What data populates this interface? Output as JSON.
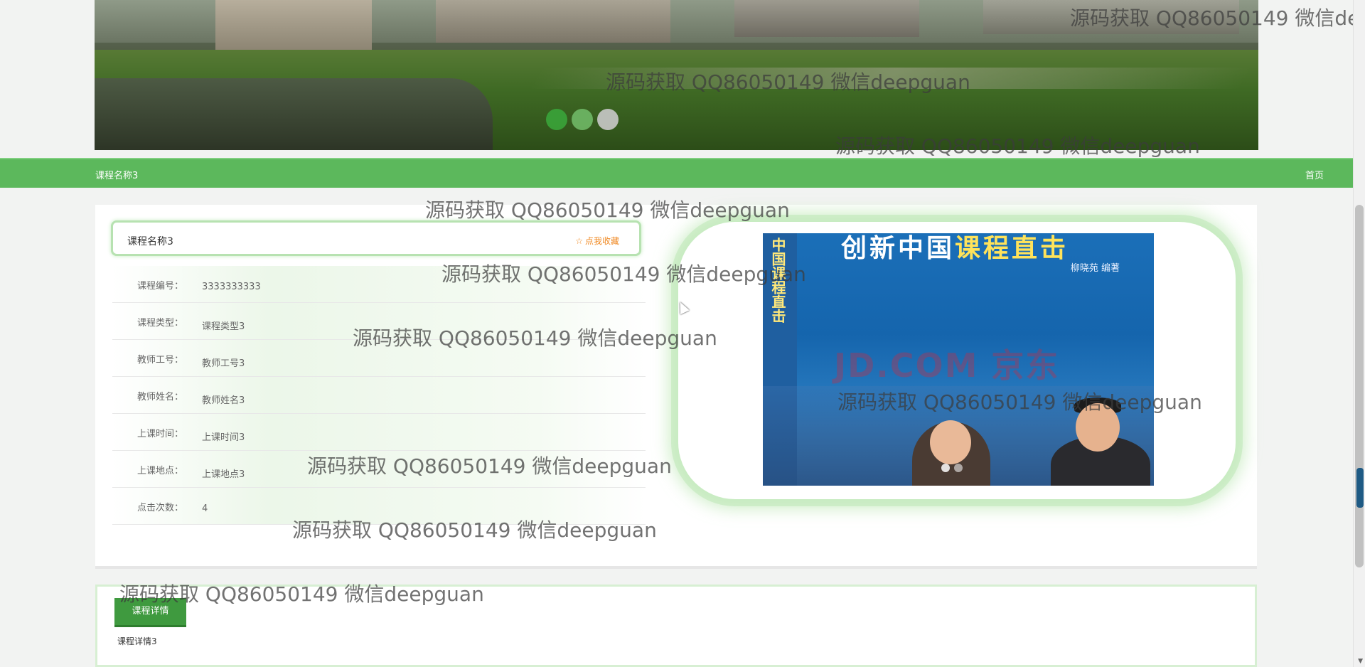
{
  "banner": {
    "slides": [
      "slide-1",
      "slide-2",
      "slide-3"
    ],
    "active_slide": 1
  },
  "navbar": {
    "title": "课程名称3",
    "home_label": "首页",
    "bg_color": "#5cb85c"
  },
  "course": {
    "title": "课程名称3",
    "favorite_label": "点我收藏",
    "favorite_icon": "star-icon",
    "fields": [
      {
        "label": "课程编号：",
        "value": "3333333333"
      },
      {
        "label": "课程类型：",
        "value": "课程类型3"
      },
      {
        "label": "教师工号：",
        "value": "教师工号3"
      },
      {
        "label": "教师姓名：",
        "value": "教师姓名3"
      },
      {
        "label": "上课时间：",
        "value": "上课时间3"
      },
      {
        "label": "上课地点：",
        "value": "上课地点3"
      },
      {
        "label": "点击次数：",
        "value": "4"
      }
    ],
    "image": {
      "spine_text": "中国课程直击",
      "cover_title_a": "创新中国",
      "cover_title_b": "课程直击",
      "author": "柳晓苑  编著",
      "watermark": "JD.COM 京东",
      "slides": [
        "img-1",
        "img-2"
      ]
    }
  },
  "detail": {
    "tab_label": "课程详情",
    "content": "课程详情3"
  },
  "watermark": {
    "text": "源码获取 QQ86050149 微信deepguan",
    "partial_text": "源码获取 QQ86050149 微信de"
  },
  "colors": {
    "accent": "#5cb85c",
    "tab": "#3f9a3f",
    "favorite": "#f08a24"
  }
}
